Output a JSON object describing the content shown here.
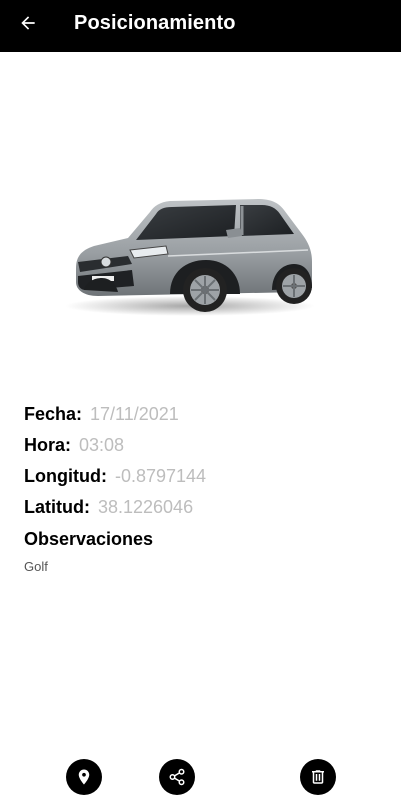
{
  "app_bar": {
    "title": "Posicionamiento",
    "back_icon": "arrow-back-icon",
    "background": "#000000",
    "title_color": "#ffffff"
  },
  "vehicle": {
    "image": "car-image"
  },
  "details": {
    "date_label": "Fecha:",
    "date_value": "17/11/2021",
    "time_label": "Hora:",
    "time_value": "03:08",
    "longitude_label": "Longitud:",
    "longitude_value": "-0.8797144",
    "latitude_label": "Latitud:",
    "latitude_value": "38.1226046",
    "observations_label": "Observaciones",
    "observations_value": "Golf",
    "value_color": "#bdbdbd"
  },
  "actions": [
    {
      "icon": "location-pin-icon"
    },
    {
      "icon": "share-icon"
    },
    {
      "icon": "trash-icon"
    }
  ]
}
